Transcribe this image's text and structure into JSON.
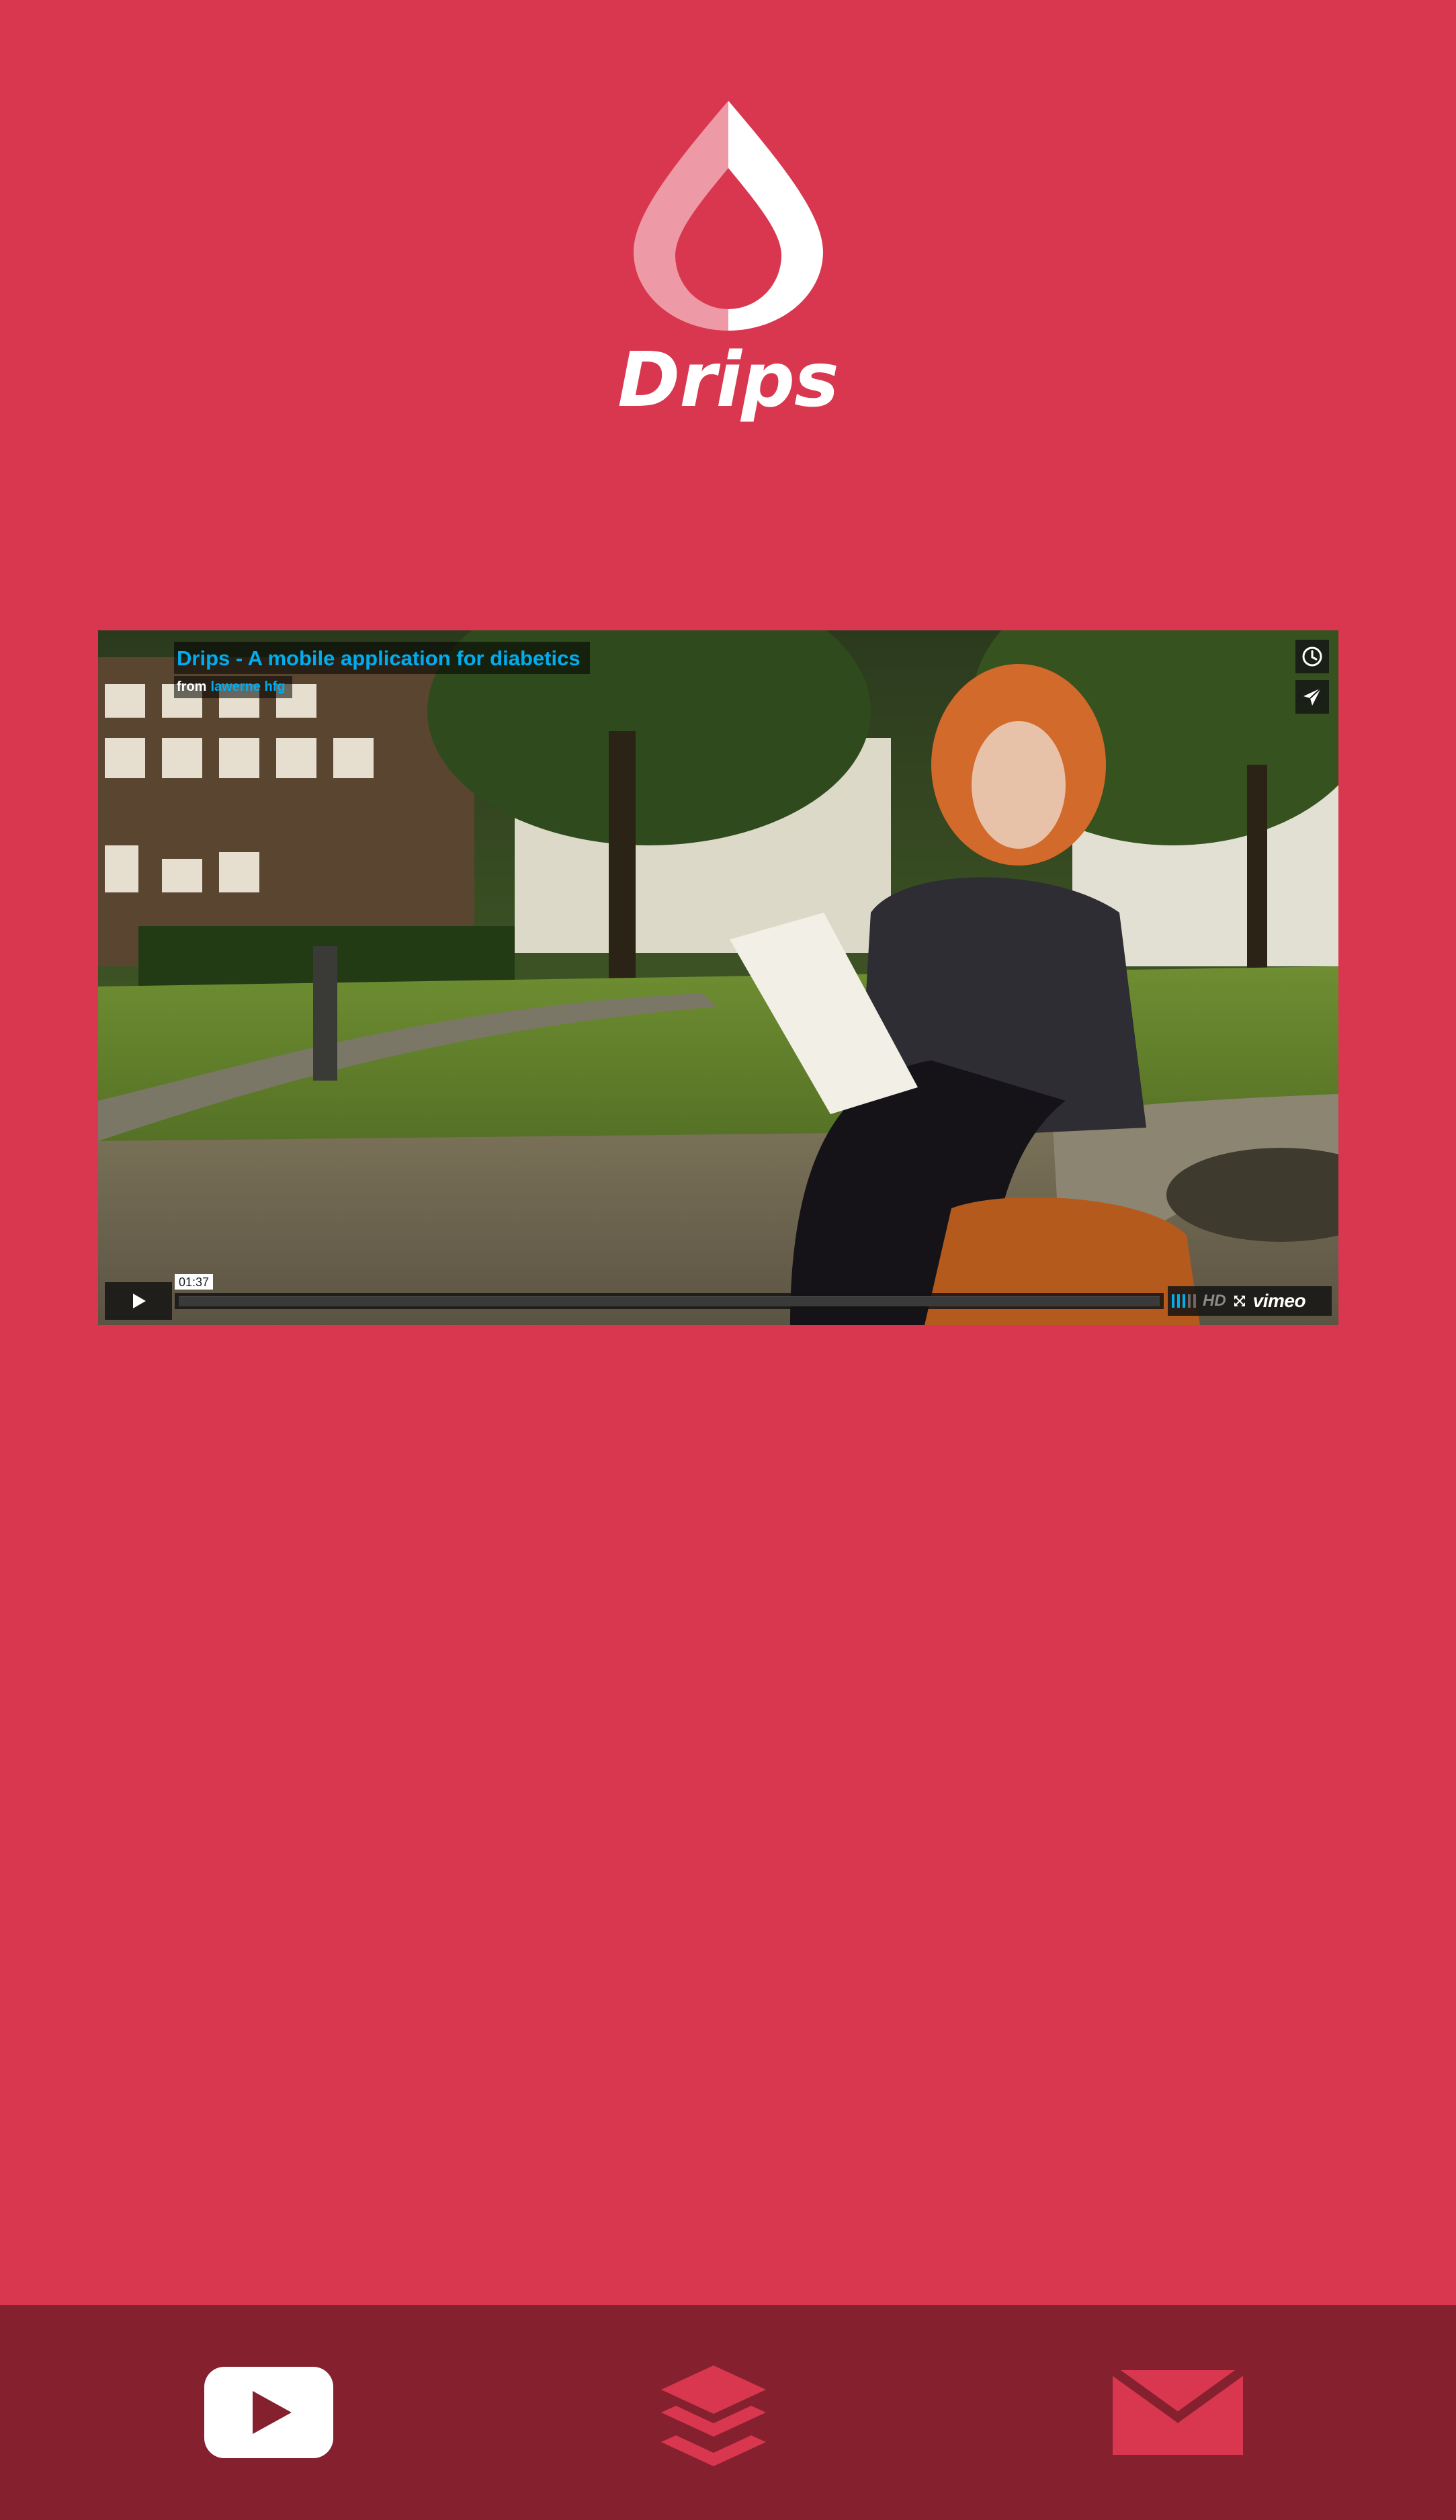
{
  "brand": {
    "name": "Drips",
    "logo_icon": "drop-logo-icon"
  },
  "video": {
    "title": "Drips - A mobile application for diabetics",
    "byline_prefix": "from",
    "author": "lawerne hfg",
    "timecode": "01:37",
    "quality_label": "HD",
    "provider_label": "vimeo",
    "progress": 0,
    "volume_level": 0.6,
    "icons": {
      "watch_later": "clock-icon",
      "share": "paper-plane-icon",
      "play": "play-icon",
      "fullscreen": "fullscreen-icon"
    }
  },
  "bottom_nav": {
    "items": [
      {
        "icon": "youtube-icon",
        "color": "#ffffff"
      },
      {
        "icon": "layers-icon",
        "color": "#d9374f"
      },
      {
        "icon": "mail-icon",
        "color": "#d9374f"
      }
    ]
  },
  "colors": {
    "background": "#d9374f",
    "bottom_bar": "#85202f",
    "player_accent": "#00adef",
    "logo": "#ffffff"
  }
}
